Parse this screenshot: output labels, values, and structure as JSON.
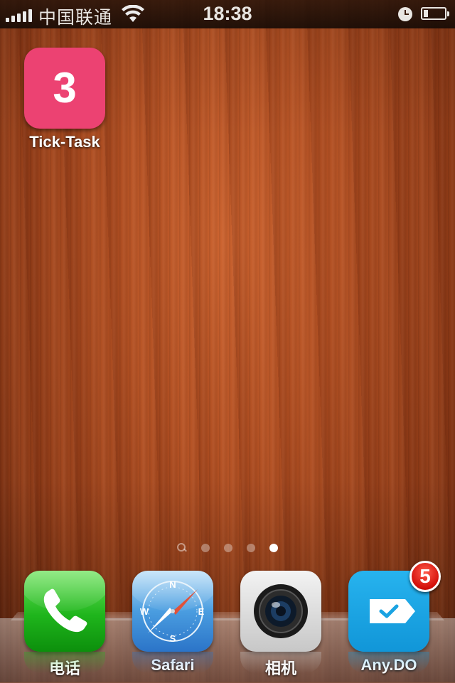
{
  "status_bar": {
    "carrier": "中国联通",
    "time": "18:38",
    "signal_bars": 5,
    "icons": [
      "signal-icon",
      "wifi-icon",
      "alarm-icon",
      "battery-icon"
    ],
    "battery_level": 0.2
  },
  "home_apps": [
    {
      "label": "Tick-Task",
      "icon_text": "3",
      "icon": "tick-task-icon",
      "color": "#ec4272"
    }
  ],
  "page_indicator": {
    "pages": 4,
    "current_page": 4,
    "has_search_page": true
  },
  "dock": {
    "apps": [
      {
        "label": "电话",
        "icon": "phone-icon"
      },
      {
        "label": "Safari",
        "icon": "safari-compass-icon"
      },
      {
        "label": "相机",
        "icon": "camera-icon"
      },
      {
        "label": "Any.DO",
        "icon": "anydo-icon",
        "badge": "5"
      }
    ]
  }
}
